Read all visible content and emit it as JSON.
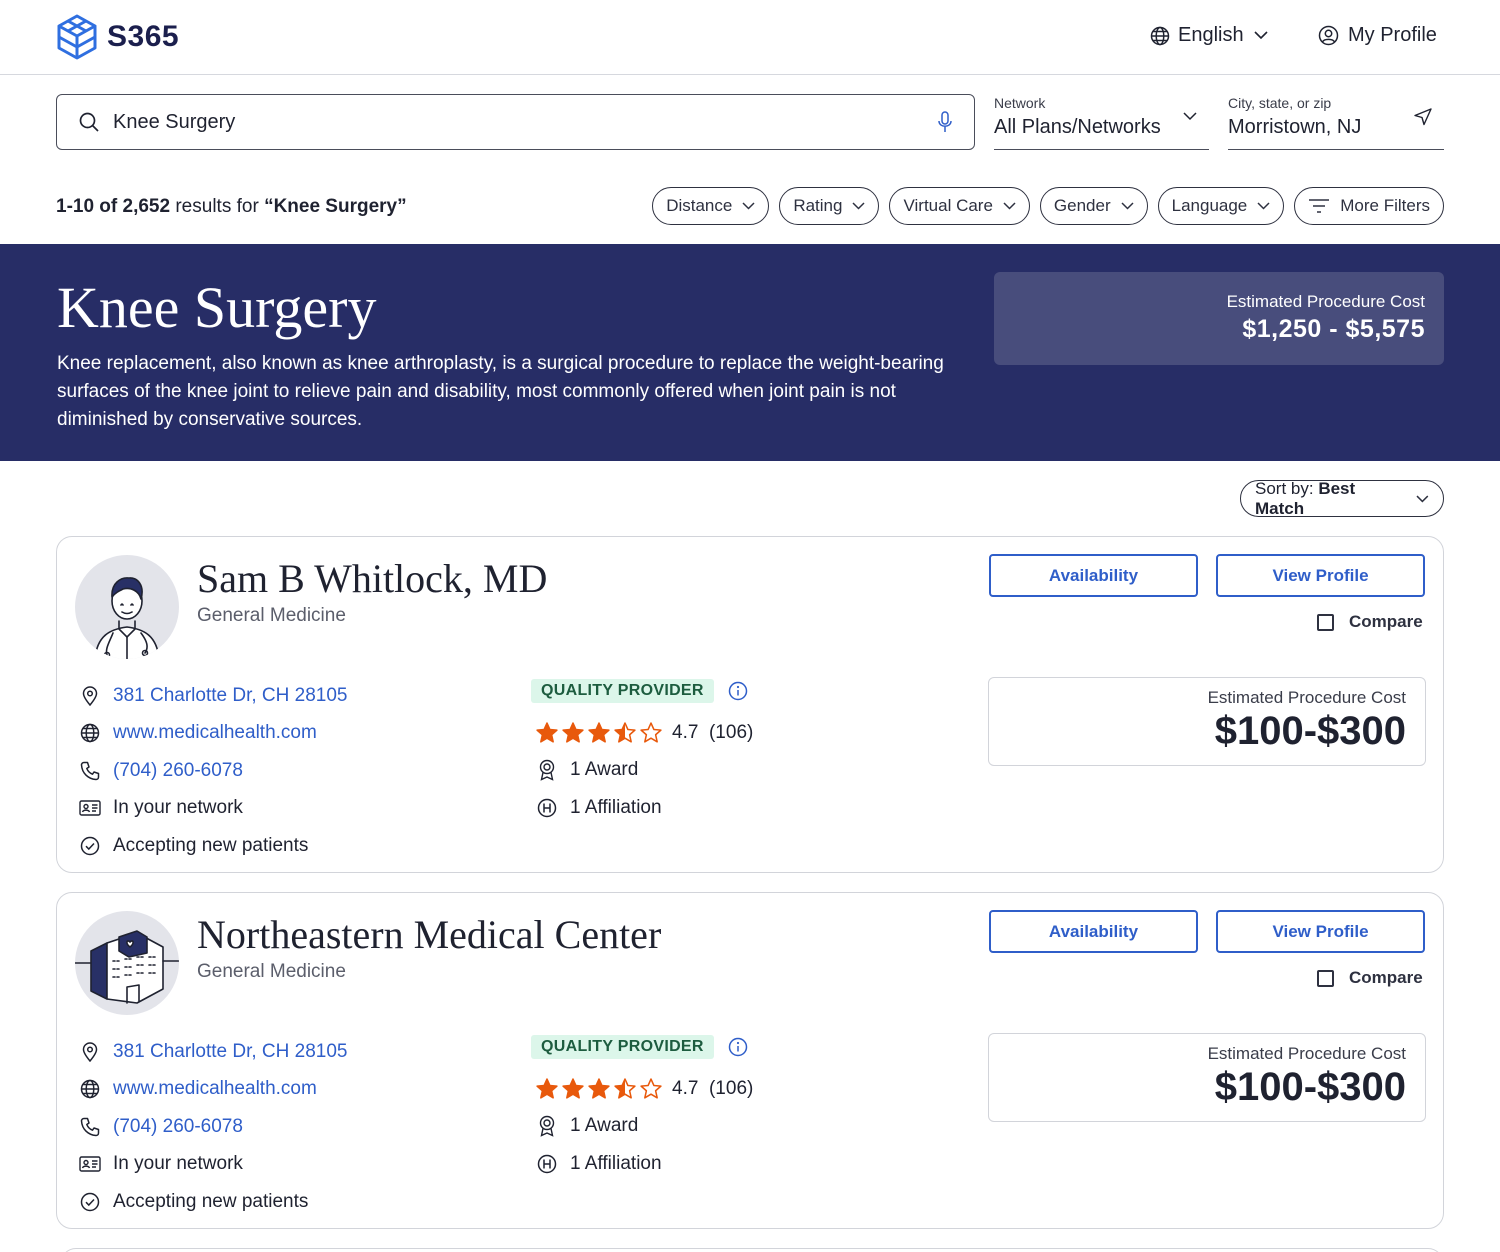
{
  "header": {
    "brand": "S365",
    "language": "English",
    "profile": "My Profile"
  },
  "search": {
    "query": "Knee Surgery",
    "network_label": "Network",
    "network_value": "All Plans/Networks",
    "location_label": "City, state, or zip",
    "location_value": "Morristown, NJ"
  },
  "results": {
    "range": "1-10 of 2,652",
    "for_text": " results for ",
    "term": "“Knee Surgery”"
  },
  "filters": [
    "Distance",
    "Rating",
    "Virtual Care",
    "Gender",
    "Language",
    "More Filters"
  ],
  "banner": {
    "title": "Knee Surgery",
    "description": "Knee replacement, also known as knee arthroplasty, is a surgical procedure to replace the weight-bearing surfaces of the knee joint to relieve pain and disability, most commonly offered when joint pain is not diminished by conservative sources.",
    "cost_label": "Estimated Procedure Cost",
    "cost_value": "$1,250 - $5,575"
  },
  "sort": {
    "label": "Sort by:",
    "value": "Best Match"
  },
  "providers": [
    {
      "name": "Sam B Whitlock, MD",
      "specialty": "General Medicine",
      "address": "381 Charlotte Dr, CH 28105",
      "website": "www.medicalhealth.com",
      "phone": "(704) 260-6078",
      "network": "In your network",
      "accepting": "Accepting new patients",
      "quality": "QUALITY PROVIDER",
      "rating": "4.7",
      "rating_value": 3.5,
      "reviews": "(106)",
      "awards": "1 Award",
      "affiliations": "1 Affiliation",
      "availability_label": "Availability",
      "view_profile_label": "View Profile",
      "compare_label": "Compare",
      "cost_label": "Estimated Procedure Cost",
      "cost_value": "$100-$300"
    },
    {
      "name": "Northeastern Medical Center",
      "specialty": "General Medicine",
      "address": "381 Charlotte Dr, CH 28105",
      "website": "www.medicalhealth.com",
      "phone": "(704) 260-6078",
      "network": "In your network",
      "accepting": "Accepting new patients",
      "quality": "QUALITY PROVIDER",
      "rating": "4.7",
      "rating_value": 3.5,
      "reviews": "(106)",
      "awards": "1 Award",
      "affiliations": "1 Affiliation",
      "availability_label": "Availability",
      "view_profile_label": "View Profile",
      "compare_label": "Compare",
      "cost_label": "Estimated Procedure Cost",
      "cost_value": "$100-$300"
    }
  ],
  "colors": {
    "banner": "#272d66",
    "link": "#2f5ec9",
    "star": "#e8590c",
    "quality_badge_bg": "#dcf6ea",
    "brand": "#2f6fe0"
  },
  "icons": [
    "logo-icon",
    "globe-icon",
    "chevron-down-icon",
    "user-circle-icon",
    "search-icon",
    "microphone-icon",
    "navigation-arrow-icon",
    "filter-lines-icon",
    "map-pin-icon",
    "id-card-icon",
    "phone-icon",
    "check-circle-icon",
    "info-icon",
    "star-icon",
    "award-icon",
    "hospital-icon"
  ]
}
